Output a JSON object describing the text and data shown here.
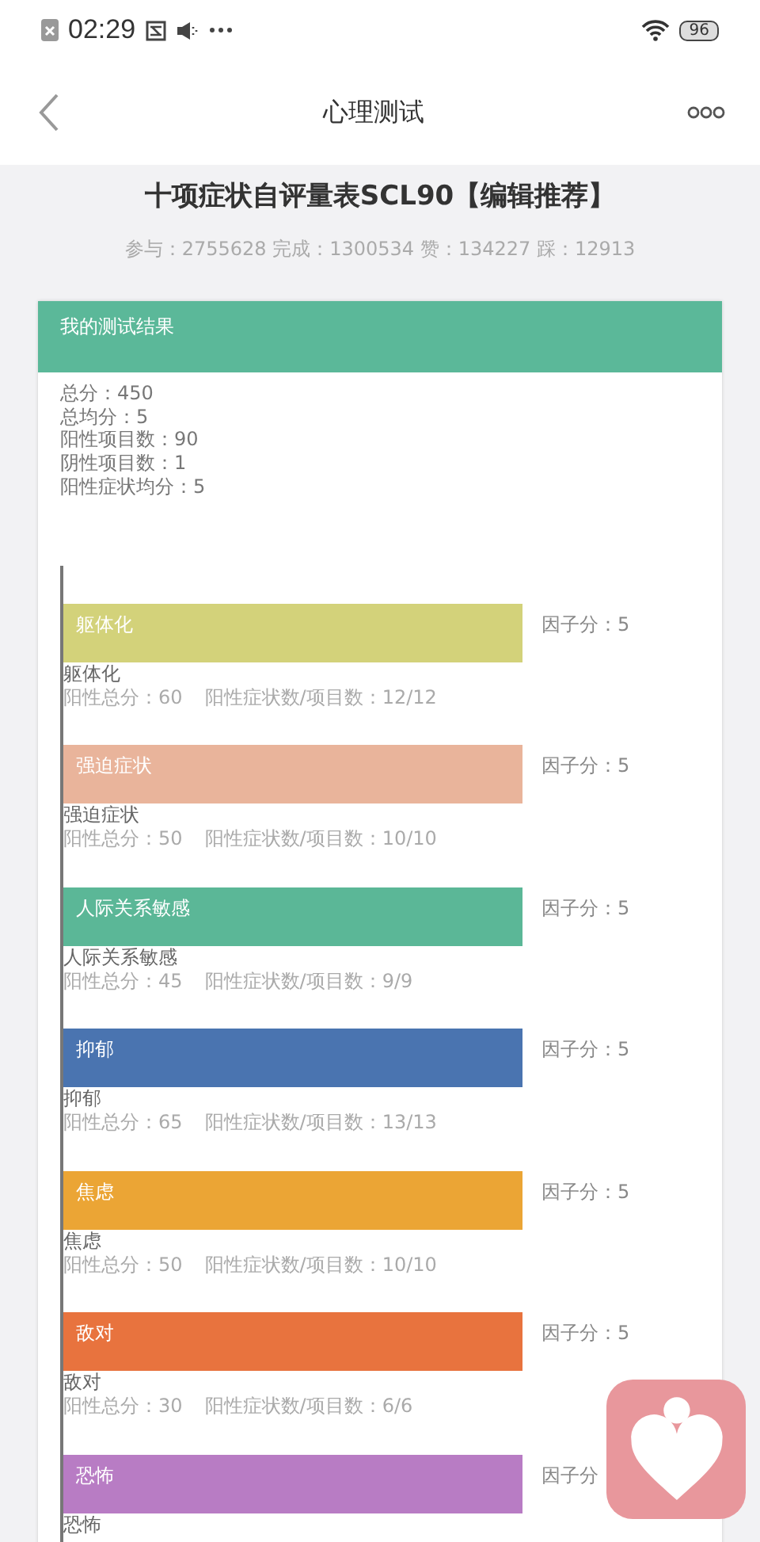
{
  "status_bar": {
    "time": "02:29",
    "battery": "96"
  },
  "nav": {
    "title": "心理测试"
  },
  "test": {
    "title": "十项症状自评量表SCL90【编辑推荐】",
    "stats": "参与：2755628 完成：1300534 赞：134227 踩：12913"
  },
  "result": {
    "header": "我的测试结果",
    "summary": [
      "总分：450",
      "总均分：5",
      "阳性项目数：90",
      "阴性项目数：1",
      "阳性症状均分：5"
    ],
    "factors": [
      {
        "label": "躯体化",
        "color": "#d3d27a",
        "score": "因子分：5",
        "name": "躯体化",
        "total": "阳性总分：60",
        "count": "阳性症状数/项目数：12/12"
      },
      {
        "label": "强迫症状",
        "color": "#e9b49b",
        "score": "因子分：5",
        "name": "强迫症状",
        "total": "阳性总分：50",
        "count": "阳性症状数/项目数：10/10"
      },
      {
        "label": "人际关系敏感",
        "color": "#5bb797",
        "score": "因子分：5",
        "name": "人际关系敏感",
        "total": "阳性总分：45",
        "count": "阳性症状数/项目数：9/9"
      },
      {
        "label": "抑郁",
        "color": "#4a74b0",
        "score": "因子分：5",
        "name": "抑郁",
        "total": "阳性总分：65",
        "count": "阳性症状数/项目数：13/13"
      },
      {
        "label": "焦虑",
        "color": "#eba535",
        "score": "因子分：5",
        "name": "焦虑",
        "total": "阳性总分：50",
        "count": "阳性症状数/项目数：10/10"
      },
      {
        "label": "敌对",
        "color": "#e8733e",
        "score": "因子分：5",
        "name": "敌对",
        "total": "阳性总分：30",
        "count": "阳性症状数/项目数：6/6"
      },
      {
        "label": "恐怖",
        "color": "#b87cc4",
        "score": "因子分",
        "name": "恐怖"
      }
    ]
  }
}
